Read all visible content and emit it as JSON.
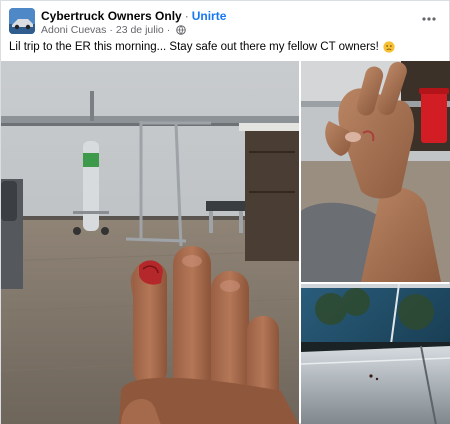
{
  "post": {
    "group_name": "Cybertruck Owners Only",
    "separator": "·",
    "join_label": "Unirte",
    "author": "Adoni Cuevas",
    "date": "23 de julio",
    "caption": "Lil trip to the ER this morning... Stay safe out there my fellow CT owners!",
    "privacy_icon": "globe-icon",
    "more_icon": "more-options-icon",
    "caption_emoji": "sad-face-emoji"
  },
  "photos": [
    {
      "name": "photo-er-room-hand",
      "subject": "injured fingertip in hospital room"
    },
    {
      "name": "photo-bandaged-finger",
      "subject": "raised hand with cut finger"
    },
    {
      "name": "photo-cybertruck-frunk-edge",
      "subject": "stainless steel frunk edge"
    }
  ]
}
